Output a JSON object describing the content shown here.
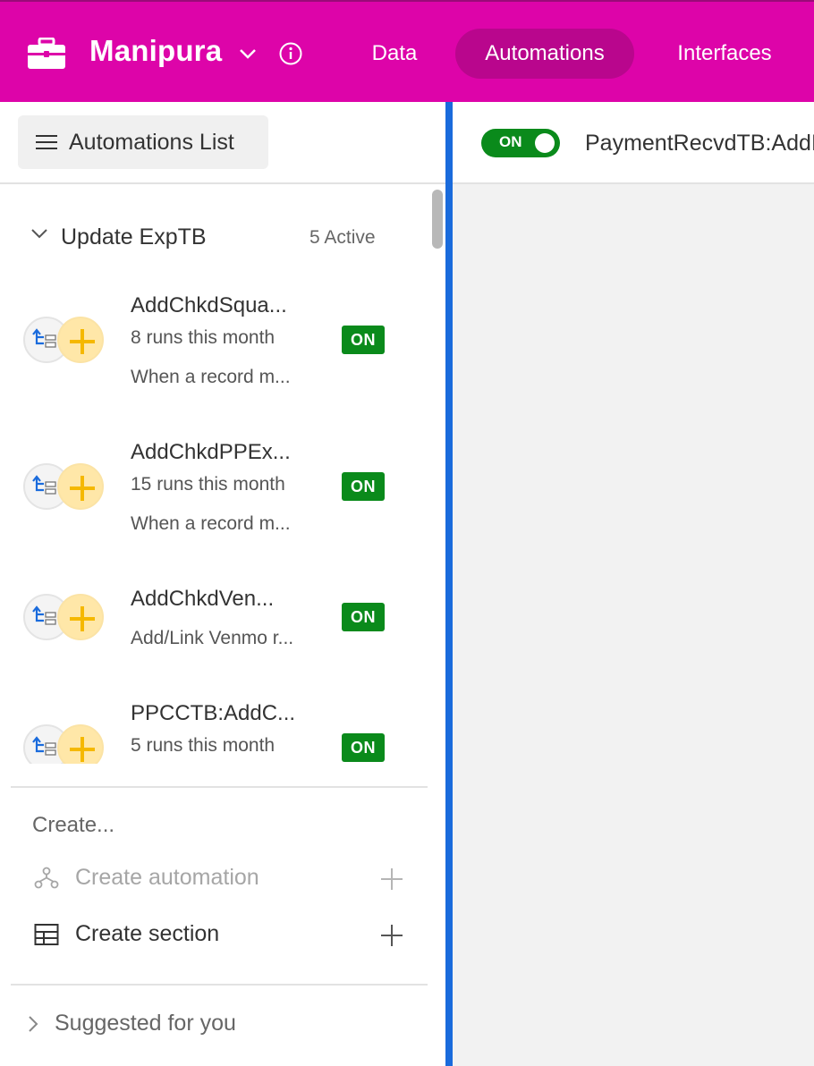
{
  "header": {
    "base_name": "Manipura",
    "nav": {
      "data": "Data",
      "automations": "Automations",
      "interfaces": "Interfaces"
    },
    "background_color": "#dd04a9",
    "active_tab_color": "#b9068d"
  },
  "sidebar": {
    "list_button_label": "Automations List",
    "section": {
      "title": "Update ExpTB",
      "count": "5 Active"
    },
    "automations": [
      {
        "name": "AddChkdSqua...",
        "runs": "8 runs this month",
        "description": "When a record m...",
        "status": "ON"
      },
      {
        "name": "AddChkdPPEx...",
        "runs": "15 runs this month",
        "description": "When a record m...",
        "status": "ON"
      },
      {
        "name": "AddChkdVen...",
        "runs": "",
        "description": "Add/Link Venmo r...",
        "status": "ON"
      },
      {
        "name": "PPCCTB:AddC...",
        "runs": "5 runs this month",
        "description": "",
        "status": "ON"
      }
    ],
    "create_heading": "Create...",
    "create_automation": "Create automation",
    "create_section": "Create section",
    "suggested": "Suggested for you"
  },
  "detail": {
    "toggle_label": "ON",
    "title": "PaymentRecvdTB:AddInvoice"
  },
  "colors": {
    "on_green": "#0a8a1b",
    "selection_border": "#1a6bdc"
  }
}
